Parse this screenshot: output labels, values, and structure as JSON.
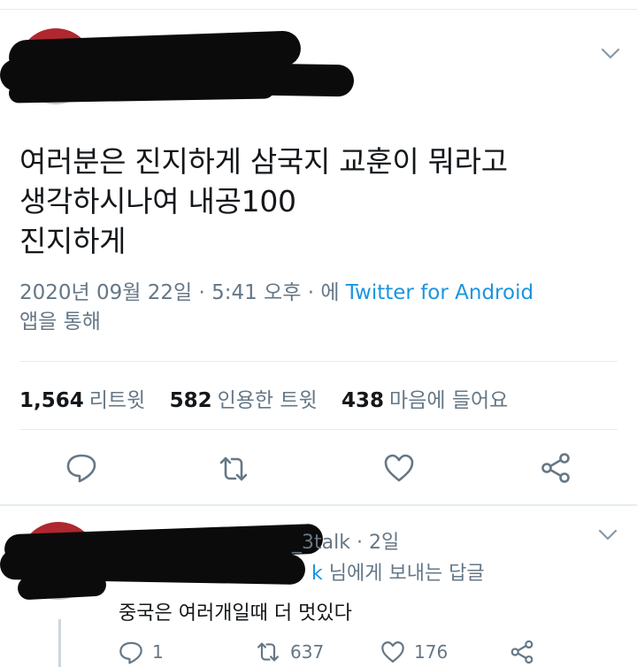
{
  "tweet": {
    "text_line1": "여러분은 진지하게 삼국지 교훈이 뭐라고",
    "text_line2": "생각하시나여 내공100",
    "text_line3": "진지하게",
    "timestamp": "2020년 09월 22일 · 5:41 오후 · 에",
    "source": "Twitter for Android",
    "source_suffix": "앱을 통해"
  },
  "stats": {
    "retweets_count": "1,564",
    "retweets_label": "리트윗",
    "quotes_count": "582",
    "quotes_label": "인용한 트윗",
    "likes_count": "438",
    "likes_label": "마음에 들어요"
  },
  "actions": {
    "icons": [
      "reply-icon",
      "retweet-icon",
      "like-icon",
      "share-icon"
    ]
  },
  "reply": {
    "handle_visible": "_3talk",
    "time": "· 2일",
    "replying_to_visible": "k",
    "replying_to_suffix": "님에게 보내는 답글",
    "text": "중국은 여러개일때 더 멋있다",
    "reply_count": "1",
    "retweet_count": "637",
    "like_count": "176"
  },
  "colors": {
    "link_blue": "#1b95e0",
    "muted_gray": "#657786",
    "divider": "#e6ecf0"
  }
}
